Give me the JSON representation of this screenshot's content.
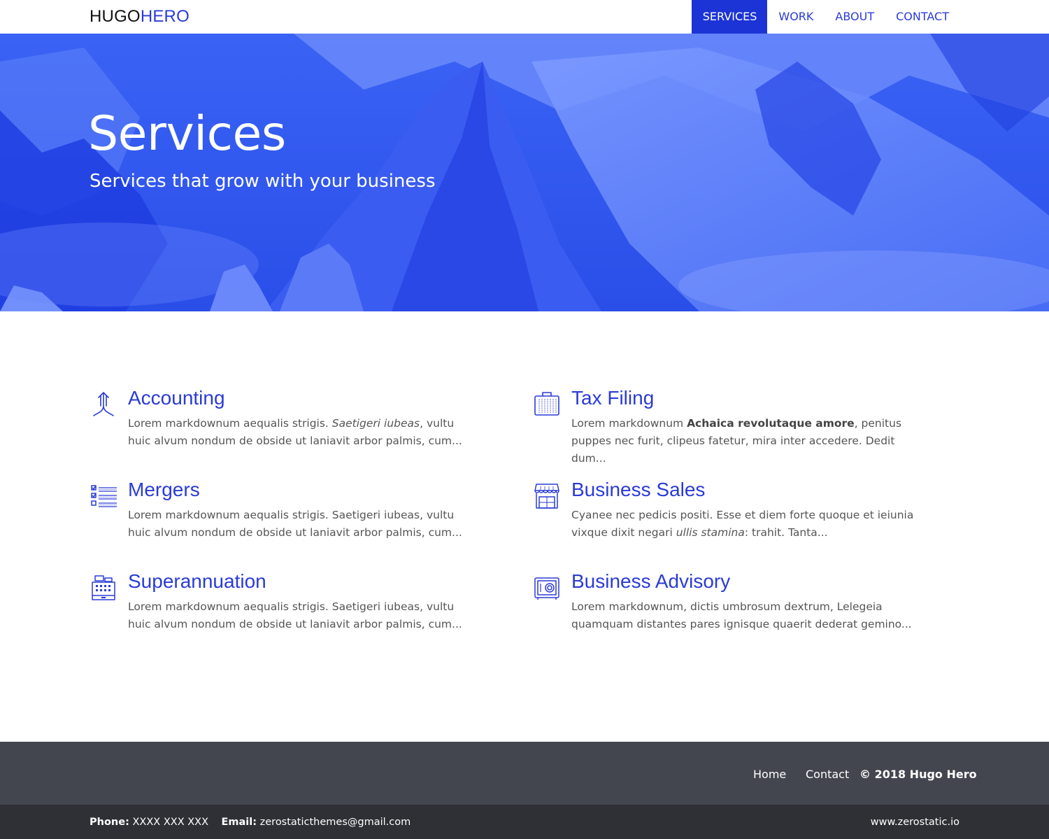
{
  "header": {
    "logo_part1": "HUGO",
    "logo_part2": "HERO",
    "nav": [
      {
        "label": "SERVICES",
        "active": true
      },
      {
        "label": "WORK",
        "active": false
      },
      {
        "label": "ABOUT",
        "active": false
      },
      {
        "label": "CONTACT",
        "active": false
      }
    ]
  },
  "hero": {
    "title": "Services",
    "subtitle": "Services that grow with your business"
  },
  "services": [
    {
      "title": "Accounting",
      "icon": "merge-arrows-icon",
      "text_a": "Lorem markdownum aequalis strigis. ",
      "text_em": "Saetigeri iubeas",
      "text_b": ", vultu huic alvum nondum de obside ut laniavit arbor palmis, cum..."
    },
    {
      "title": "Tax Filing",
      "icon": "briefcase-icon",
      "text_a": "Lorem markdownum ",
      "text_strong": "Achaica revolutaque amore",
      "text_b": ", penitus puppes nec furit, clipeus fatetur, mira inter accedere. Dedit dum..."
    },
    {
      "title": "Mergers",
      "icon": "checklist-icon",
      "text_a": "Lorem markdownum aequalis strigis. Saetigeri iubeas, vultu huic alvum nondum de obside ut laniavit arbor palmis, cum..."
    },
    {
      "title": "Business Sales",
      "icon": "storefront-icon",
      "text_a": "Cyanee nec pedicis positi. Esse et diem forte quoque et ieiunia vixque dixit negari ",
      "text_em": "ullis stamina",
      "text_b": ": trahit. Tanta..."
    },
    {
      "title": "Superannuation",
      "icon": "cash-register-icon",
      "text_a": "Lorem markdownum aequalis strigis. Saetigeri iubeas, vultu huic alvum nondum de obside ut laniavit arbor palmis, cum..."
    },
    {
      "title": "Business Advisory",
      "icon": "safe-icon",
      "text_a": "Lorem markdownum, dictis umbrosum dextrum, Lelegeia quamquam distantes pares ignisque quaerit dederat gemino..."
    }
  ],
  "footer": {
    "links": [
      "Home",
      "Contact"
    ],
    "copyright": "© 2018 Hugo Hero",
    "phone_label": "Phone:",
    "phone": "XXXX XXX XXX",
    "email_label": "Email:",
    "email": "zerostaticthemes@gmail.com",
    "site": "www.zerostatic.io"
  },
  "colors": {
    "accent": "#2a3bd6",
    "nav_active_bg": "#1c34d6",
    "hero_bg": "#2b54f0",
    "footer_bg": "#43464e",
    "subfooter_bg": "#2e3035"
  }
}
